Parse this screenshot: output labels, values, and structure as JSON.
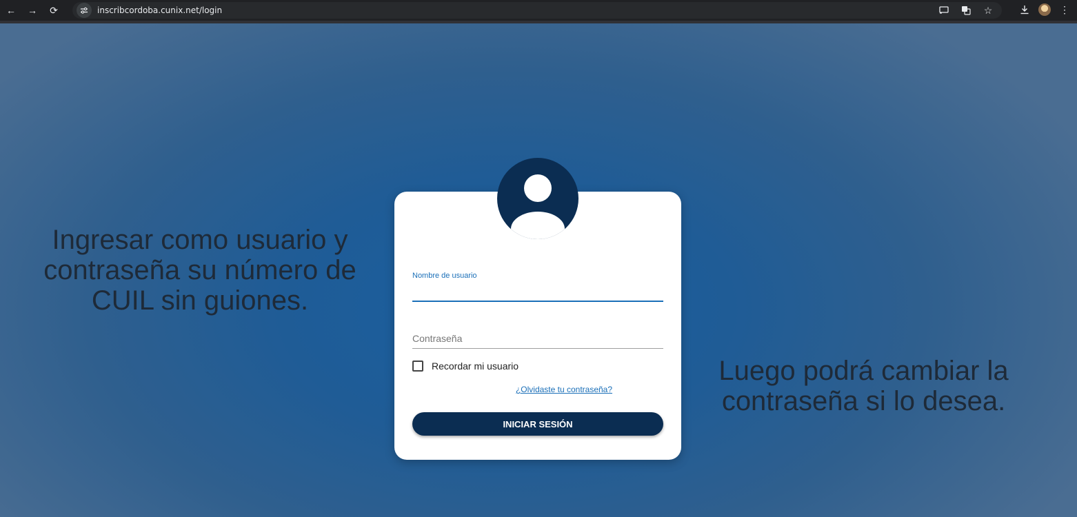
{
  "browser": {
    "url": "inscribcordoba.cunix.net/login",
    "icons": [
      "back-arrow-icon",
      "forward-arrow-icon",
      "reload-icon",
      "site-info-icon",
      "cast-icon",
      "translate-icon",
      "bookmark-star-icon",
      "download-icon",
      "profile-avatar",
      "menu-dots-icon"
    ]
  },
  "page": {
    "instruction_left": "Ingresar como usuario y contraseña su número de CUIL sin guiones.",
    "instruction_right": "Luego podrá cambiar la contraseña si lo desea."
  },
  "login": {
    "username_label": "Nombre de usuario",
    "username_value": "",
    "password_placeholder": "Contraseña",
    "remember_label": "Recordar mi usuario",
    "remember_checked": false,
    "forgot_link": "¿Olvidaste tu contraseña?",
    "submit_label": "INICIAR SESIÓN"
  },
  "colors": {
    "primary": "#0b2d52",
    "accent": "#1a6fb8",
    "background": "#1f5c96"
  }
}
